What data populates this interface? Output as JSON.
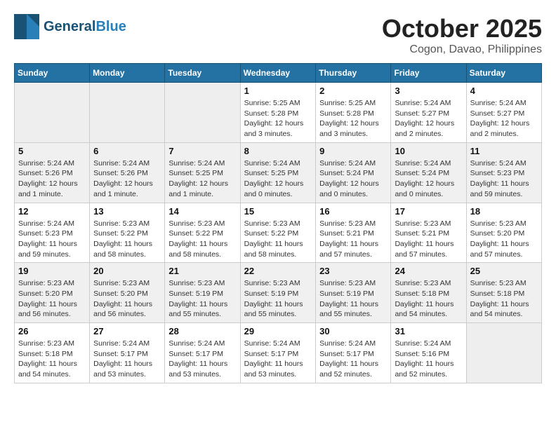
{
  "header": {
    "logo_general": "General",
    "logo_blue": "Blue",
    "month": "October 2025",
    "location": "Cogon, Davao, Philippines"
  },
  "weekdays": [
    "Sunday",
    "Monday",
    "Tuesday",
    "Wednesday",
    "Thursday",
    "Friday",
    "Saturday"
  ],
  "weeks": [
    [
      {
        "day": "",
        "sunrise": "",
        "sunset": "",
        "daylight": ""
      },
      {
        "day": "",
        "sunrise": "",
        "sunset": "",
        "daylight": ""
      },
      {
        "day": "",
        "sunrise": "",
        "sunset": "",
        "daylight": ""
      },
      {
        "day": "1",
        "sunrise": "Sunrise: 5:25 AM",
        "sunset": "Sunset: 5:28 PM",
        "daylight": "Daylight: 12 hours and 3 minutes."
      },
      {
        "day": "2",
        "sunrise": "Sunrise: 5:25 AM",
        "sunset": "Sunset: 5:28 PM",
        "daylight": "Daylight: 12 hours and 3 minutes."
      },
      {
        "day": "3",
        "sunrise": "Sunrise: 5:24 AM",
        "sunset": "Sunset: 5:27 PM",
        "daylight": "Daylight: 12 hours and 2 minutes."
      },
      {
        "day": "4",
        "sunrise": "Sunrise: 5:24 AM",
        "sunset": "Sunset: 5:27 PM",
        "daylight": "Daylight: 12 hours and 2 minutes."
      }
    ],
    [
      {
        "day": "5",
        "sunrise": "Sunrise: 5:24 AM",
        "sunset": "Sunset: 5:26 PM",
        "daylight": "Daylight: 12 hours and 1 minute."
      },
      {
        "day": "6",
        "sunrise": "Sunrise: 5:24 AM",
        "sunset": "Sunset: 5:26 PM",
        "daylight": "Daylight: 12 hours and 1 minute."
      },
      {
        "day": "7",
        "sunrise": "Sunrise: 5:24 AM",
        "sunset": "Sunset: 5:25 PM",
        "daylight": "Daylight: 12 hours and 1 minute."
      },
      {
        "day": "8",
        "sunrise": "Sunrise: 5:24 AM",
        "sunset": "Sunset: 5:25 PM",
        "daylight": "Daylight: 12 hours and 0 minutes."
      },
      {
        "day": "9",
        "sunrise": "Sunrise: 5:24 AM",
        "sunset": "Sunset: 5:24 PM",
        "daylight": "Daylight: 12 hours and 0 minutes."
      },
      {
        "day": "10",
        "sunrise": "Sunrise: 5:24 AM",
        "sunset": "Sunset: 5:24 PM",
        "daylight": "Daylight: 12 hours and 0 minutes."
      },
      {
        "day": "11",
        "sunrise": "Sunrise: 5:24 AM",
        "sunset": "Sunset: 5:23 PM",
        "daylight": "Daylight: 11 hours and 59 minutes."
      }
    ],
    [
      {
        "day": "12",
        "sunrise": "Sunrise: 5:24 AM",
        "sunset": "Sunset: 5:23 PM",
        "daylight": "Daylight: 11 hours and 59 minutes."
      },
      {
        "day": "13",
        "sunrise": "Sunrise: 5:23 AM",
        "sunset": "Sunset: 5:22 PM",
        "daylight": "Daylight: 11 hours and 58 minutes."
      },
      {
        "day": "14",
        "sunrise": "Sunrise: 5:23 AM",
        "sunset": "Sunset: 5:22 PM",
        "daylight": "Daylight: 11 hours and 58 minutes."
      },
      {
        "day": "15",
        "sunrise": "Sunrise: 5:23 AM",
        "sunset": "Sunset: 5:22 PM",
        "daylight": "Daylight: 11 hours and 58 minutes."
      },
      {
        "day": "16",
        "sunrise": "Sunrise: 5:23 AM",
        "sunset": "Sunset: 5:21 PM",
        "daylight": "Daylight: 11 hours and 57 minutes."
      },
      {
        "day": "17",
        "sunrise": "Sunrise: 5:23 AM",
        "sunset": "Sunset: 5:21 PM",
        "daylight": "Daylight: 11 hours and 57 minutes."
      },
      {
        "day": "18",
        "sunrise": "Sunrise: 5:23 AM",
        "sunset": "Sunset: 5:20 PM",
        "daylight": "Daylight: 11 hours and 57 minutes."
      }
    ],
    [
      {
        "day": "19",
        "sunrise": "Sunrise: 5:23 AM",
        "sunset": "Sunset: 5:20 PM",
        "daylight": "Daylight: 11 hours and 56 minutes."
      },
      {
        "day": "20",
        "sunrise": "Sunrise: 5:23 AM",
        "sunset": "Sunset: 5:20 PM",
        "daylight": "Daylight: 11 hours and 56 minutes."
      },
      {
        "day": "21",
        "sunrise": "Sunrise: 5:23 AM",
        "sunset": "Sunset: 5:19 PM",
        "daylight": "Daylight: 11 hours and 55 minutes."
      },
      {
        "day": "22",
        "sunrise": "Sunrise: 5:23 AM",
        "sunset": "Sunset: 5:19 PM",
        "daylight": "Daylight: 11 hours and 55 minutes."
      },
      {
        "day": "23",
        "sunrise": "Sunrise: 5:23 AM",
        "sunset": "Sunset: 5:19 PM",
        "daylight": "Daylight: 11 hours and 55 minutes."
      },
      {
        "day": "24",
        "sunrise": "Sunrise: 5:23 AM",
        "sunset": "Sunset: 5:18 PM",
        "daylight": "Daylight: 11 hours and 54 minutes."
      },
      {
        "day": "25",
        "sunrise": "Sunrise: 5:23 AM",
        "sunset": "Sunset: 5:18 PM",
        "daylight": "Daylight: 11 hours and 54 minutes."
      }
    ],
    [
      {
        "day": "26",
        "sunrise": "Sunrise: 5:23 AM",
        "sunset": "Sunset: 5:18 PM",
        "daylight": "Daylight: 11 hours and 54 minutes."
      },
      {
        "day": "27",
        "sunrise": "Sunrise: 5:24 AM",
        "sunset": "Sunset: 5:17 PM",
        "daylight": "Daylight: 11 hours and 53 minutes."
      },
      {
        "day": "28",
        "sunrise": "Sunrise: 5:24 AM",
        "sunset": "Sunset: 5:17 PM",
        "daylight": "Daylight: 11 hours and 53 minutes."
      },
      {
        "day": "29",
        "sunrise": "Sunrise: 5:24 AM",
        "sunset": "Sunset: 5:17 PM",
        "daylight": "Daylight: 11 hours and 53 minutes."
      },
      {
        "day": "30",
        "sunrise": "Sunrise: 5:24 AM",
        "sunset": "Sunset: 5:17 PM",
        "daylight": "Daylight: 11 hours and 52 minutes."
      },
      {
        "day": "31",
        "sunrise": "Sunrise: 5:24 AM",
        "sunset": "Sunset: 5:16 PM",
        "daylight": "Daylight: 11 hours and 52 minutes."
      },
      {
        "day": "",
        "sunrise": "",
        "sunset": "",
        "daylight": ""
      }
    ]
  ]
}
